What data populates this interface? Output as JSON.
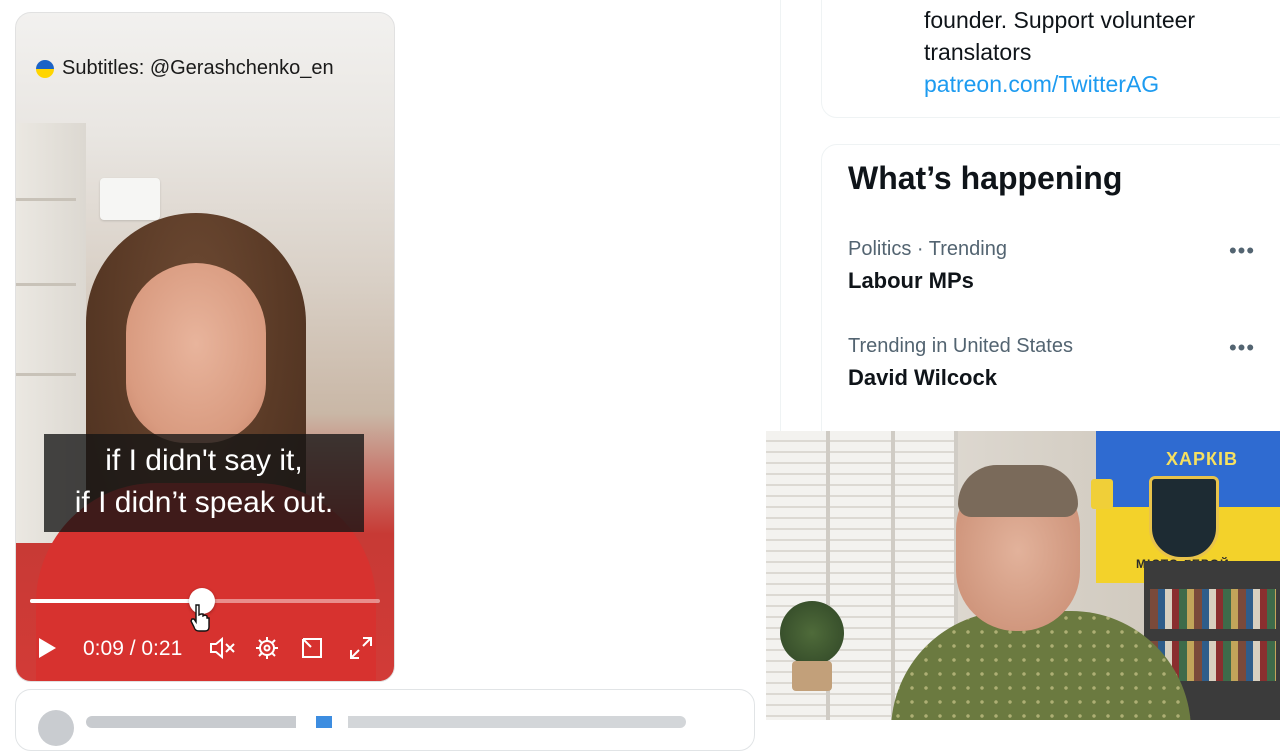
{
  "video": {
    "subtitles_credit": "Subtitles: @Gerashchenko_en",
    "caption_line1": "if I didn't say it,",
    "caption_line2": "if I didn’t speak out.",
    "time_display": "0:09 / 0:21",
    "progress_fraction": 0.49,
    "icons": {
      "play": "play-icon",
      "mute": "volume-muted-icon",
      "settings": "gear-icon",
      "pip": "picture-in-picture-icon",
      "fullscreen": "fullscreen-icon"
    }
  },
  "profile_bio": {
    "line1": "founder. Support volunteer",
    "line2": "translators",
    "link": "patreon.com/TwitterAG"
  },
  "trends": {
    "title": "What’s happening",
    "items": [
      {
        "meta": "Politics · Trending",
        "name": "Labour MPs"
      },
      {
        "meta": "Trending in United States",
        "name": "David Wilcock"
      }
    ],
    "more_label": "•••"
  },
  "webcam": {
    "flag_text": "ХАРКІВ",
    "flag_bottom_text": "МІСТО-ГЕРОЙ"
  },
  "colors": {
    "link": "#1d9bf0",
    "secondary_text": "#536471",
    "primary_text": "#0f1419"
  }
}
